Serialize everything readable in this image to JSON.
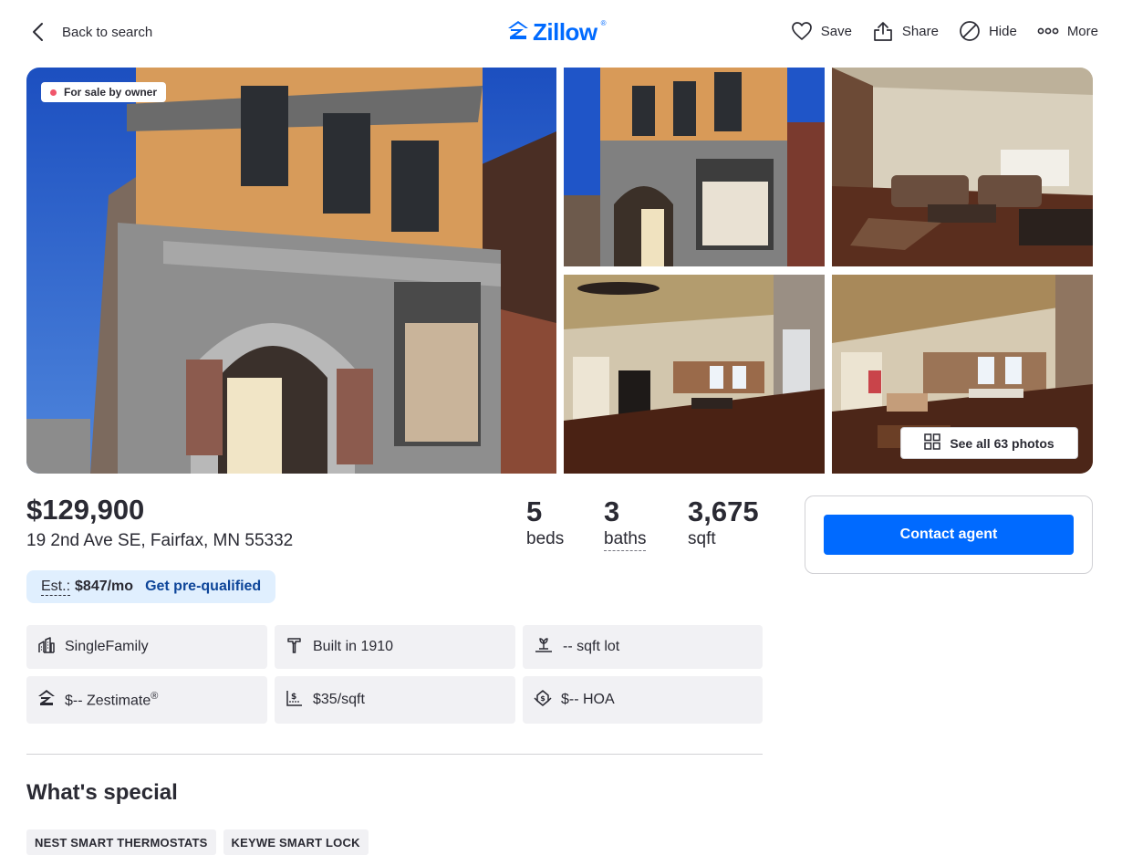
{
  "header": {
    "back_label": "Back to search",
    "logo_text": "Zillow",
    "logo_mark": "®",
    "actions": [
      {
        "label": "Save",
        "icon": "heart-icon"
      },
      {
        "label": "Share",
        "icon": "share-icon"
      },
      {
        "label": "Hide",
        "icon": "hide-icon"
      },
      {
        "label": "More",
        "icon": "more-icon"
      }
    ]
  },
  "gallery": {
    "badge": "For sale by owner",
    "see_all_label": "See all 63 photos"
  },
  "listing": {
    "price": "$129,900",
    "address": "19 2nd Ave SE, Fairfax, MN 55332",
    "beds_num": "5",
    "beds_label": "beds",
    "baths_num": "3",
    "baths_label": "baths",
    "sqft_num": "3,675",
    "sqft_label": "sqft",
    "est_label": "Est.:",
    "est_amount": "$847/mo",
    "est_link": "Get pre-qualified"
  },
  "contact": {
    "button_label": "Contact agent"
  },
  "details": {
    "type": "SingleFamily",
    "built": "Built in 1910",
    "lot": "-- sqft lot",
    "zestimate": "$-- Zestimate",
    "zestimate_mark": "®",
    "price_per_sqft": "$35/sqft",
    "hoa": "$-- HOA"
  },
  "special": {
    "title": "What's special",
    "chips": [
      "NEST SMART THERMOSTATS",
      "KEYWE SMART LOCK"
    ]
  },
  "colors": {
    "brand": "#006aff",
    "link": "#0d4599",
    "badge_dot": "#f0566b",
    "est_bg": "#e0effe",
    "tile_bg": "#f1f1f4"
  }
}
